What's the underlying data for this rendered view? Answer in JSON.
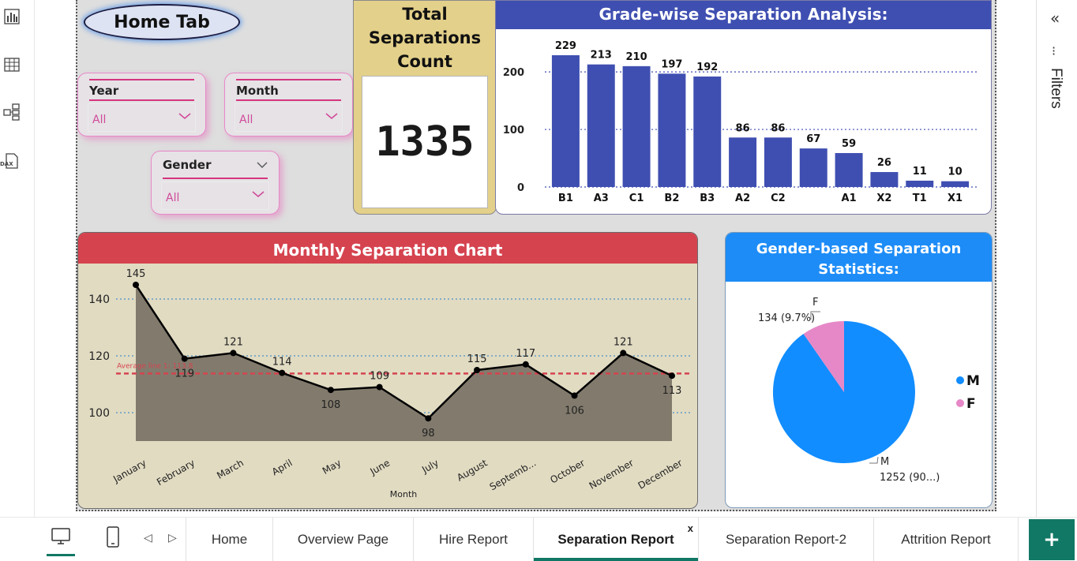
{
  "home_tab": {
    "label": "Home Tab"
  },
  "slicers": {
    "year": {
      "title": "Year",
      "value": "All"
    },
    "month": {
      "title": "Month",
      "value": "All"
    },
    "gender": {
      "title": "Gender",
      "value": "All"
    }
  },
  "kpi": {
    "title_line1": "Total",
    "title_line2": "Separations",
    "title_line3": "Count",
    "value": "1335"
  },
  "grade_chart": {
    "title": "Grade-wise Separation Analysis:",
    "type": "bar",
    "categories": [
      "B1",
      "A3",
      "C1",
      "B2",
      "B3",
      "A2",
      "C2",
      "",
      "A1",
      "X2",
      "T1",
      "X1"
    ],
    "values": [
      229,
      213,
      210,
      197,
      192,
      86,
      86,
      67,
      59,
      26,
      11,
      10
    ],
    "ylim": [
      0,
      229
    ],
    "yticks": [
      "0",
      "100",
      "200"
    ],
    "color": "#3f4fb1"
  },
  "monthly_chart": {
    "title": "Monthly Separation Chart",
    "type": "area",
    "categories": [
      "January",
      "February",
      "March",
      "April",
      "May",
      "June",
      "July",
      "August",
      "Septemb...",
      "October",
      "November",
      "December"
    ],
    "values": [
      145,
      119,
      121,
      114,
      108,
      109,
      98,
      115,
      117,
      106,
      121,
      113
    ],
    "xlabel": "Month",
    "yticks": [
      "100",
      "120",
      "140"
    ],
    "average_label": "Average line 1: 113.8",
    "average_value": 113.8,
    "area_color": "#827b6d",
    "avg_color": "#d5434f"
  },
  "gender_chart": {
    "title_line1": "Gender-based Separation",
    "title_line2": "Statistics:",
    "type": "pie",
    "slices": [
      {
        "name": "M",
        "value": 1252,
        "label_name": "M",
        "label_value": "1252 (90...)",
        "color": "#118dff"
      },
      {
        "name": "F",
        "value": 134,
        "label_name": "F",
        "label_value": "134 (9.7%)",
        "color": "#e688c7"
      }
    ],
    "legend": [
      {
        "name": "M",
        "color": "#118dff"
      },
      {
        "name": "F",
        "color": "#e688c7"
      }
    ]
  },
  "chart_data": [
    {
      "type": "bar",
      "title": "Grade-wise Separation Analysis:",
      "categories": [
        "B1",
        "A3",
        "C1",
        "B2",
        "B3",
        "A2",
        "C2",
        "",
        "A1",
        "X2",
        "T1",
        "X1"
      ],
      "values": [
        229,
        213,
        210,
        197,
        192,
        86,
        86,
        67,
        59,
        26,
        11,
        10
      ],
      "ylim": [
        0,
        229
      ]
    },
    {
      "type": "area",
      "title": "Monthly Separation Chart",
      "categories": [
        "January",
        "February",
        "March",
        "April",
        "May",
        "June",
        "July",
        "August",
        "Septemb...",
        "October",
        "November",
        "December"
      ],
      "values": [
        145,
        119,
        121,
        114,
        108,
        109,
        98,
        115,
        117,
        106,
        121,
        113
      ],
      "xlabel": "Month"
    },
    {
      "type": "pie",
      "title": "Gender-based Separation Statistics:",
      "categories": [
        "M",
        "F"
      ],
      "values": [
        1252,
        134
      ],
      "legend": "right"
    }
  ],
  "filters": {
    "label": "Filters",
    "collapse_glyph": "«",
    "more_glyph": "⁝"
  },
  "tabs": [
    {
      "label": "Home"
    },
    {
      "label": "Overview Page"
    },
    {
      "label": "Hire Report"
    },
    {
      "label": "Separation Report",
      "active": true
    },
    {
      "label": "Separation Report-2"
    },
    {
      "label": "Attrition Report"
    }
  ],
  "tab_close_glyph": "x",
  "add_page_glyph": "+",
  "nav": {
    "prev_glyph": "◁",
    "next_glyph": "▷"
  },
  "rail": {
    "dax_label": "DAX"
  }
}
